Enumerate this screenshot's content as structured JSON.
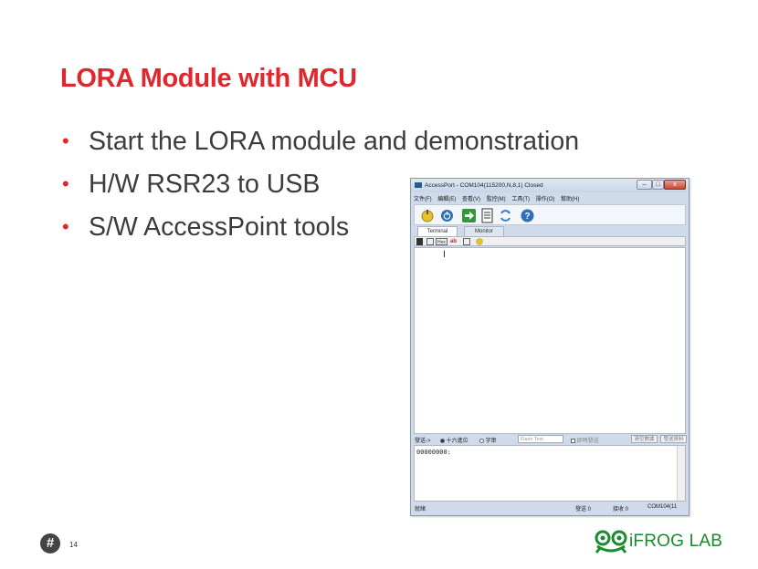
{
  "slide": {
    "title": "LORA Module with MCU",
    "bullets": [
      "Start the LORA module and demonstration",
      "H/W RSR23 to USB",
      "S/W AccessPoint tools"
    ],
    "page_number": "14",
    "footer_badge": "#",
    "brand": "iFROG LAB"
  },
  "window": {
    "title": "AccessPort - COM104(115200,N,8,1) Closed",
    "controls": {
      "minimize": "–",
      "maximize": "□",
      "close": "x"
    },
    "menu": [
      "文件(F)",
      "編輯(E)",
      "查看(V)",
      "監控(M)",
      "工具(T)",
      "操作(O)",
      "幫助(H)"
    ],
    "tabs": [
      "Terminal",
      "Monitor"
    ],
    "active_tab": "Terminal",
    "subbar": {
      "hex": "Hex",
      "ab": "ab"
    },
    "sendbar": {
      "label": "發送->",
      "radio_hex": "十六進位",
      "radio_char": "字串",
      "dropdown": "Flash Text",
      "checkbox": "即時發送",
      "btn_clear": "清空數據",
      "btn_send": "發送資料"
    },
    "send_text": "00000000:",
    "status": {
      "left": "就緒",
      "sent": "發送 0",
      "received": "接收 0",
      "port": "COM104(11"
    }
  },
  "colors": {
    "title": "#e0282c",
    "brand": "#1a8a2e",
    "window_frame": "#cfdbeb"
  }
}
